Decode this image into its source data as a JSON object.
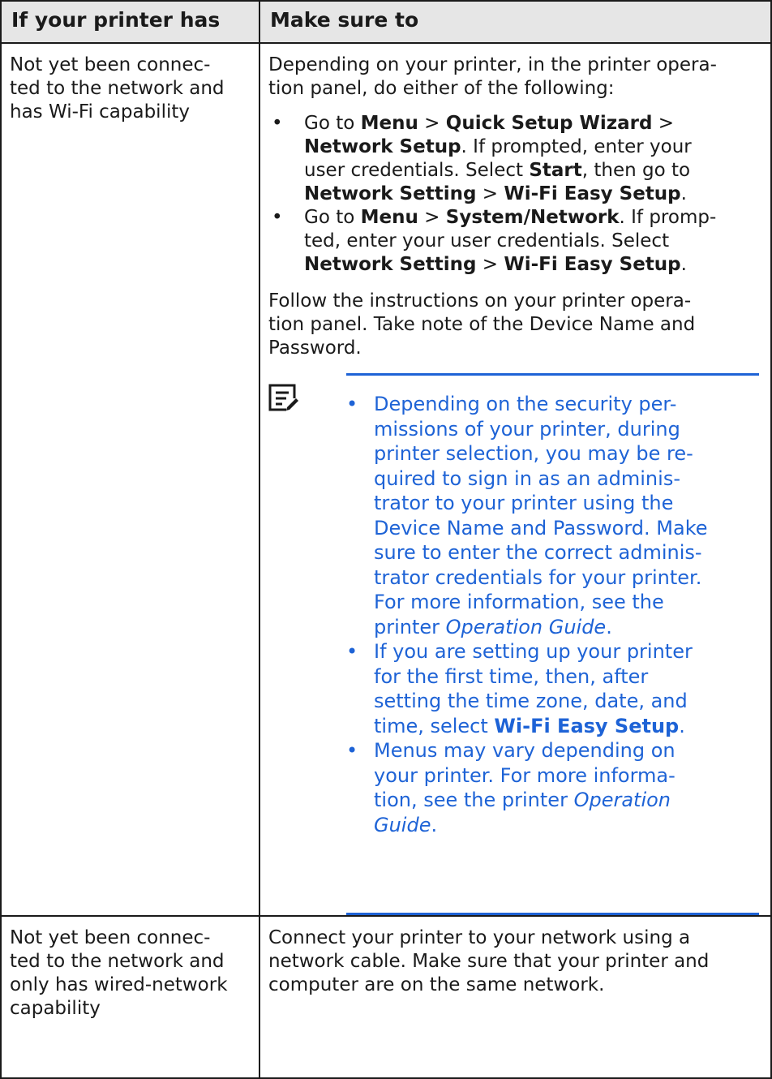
{
  "table": {
    "headers": [
      "If your printer has",
      "Make sure to"
    ],
    "row1": {
      "condition_lines": [
        "Not yet been connec-",
        "ted to the network and",
        "has Wi-Fi capability"
      ],
      "intro_lines": [
        "Depending on your printer, in the printer opera-",
        "tion panel, do either of the following:"
      ],
      "bullet": "•",
      "step1": {
        "t1": "Go to ",
        "b1": "Menu",
        "t2": " > ",
        "b2": "Quick Setup Wizard",
        "t3": " >",
        "b3": "Network Setup",
        "t4": ". If prompted, enter your",
        "t5": "user credentials. Select ",
        "b4": "Start",
        "t6": ", then go to",
        "b5": "Network Setting",
        "t7": " > ",
        "b6": "Wi-Fi Easy Setup",
        "t8": "."
      },
      "step2": {
        "t1": "Go to ",
        "b1": "Menu",
        "t2": " > ",
        "b2": "System/Network",
        "t3": ". If promp-",
        "t4": "ted, enter your user credentials. Select",
        "b3": "Network Setting",
        "t5": " > ",
        "b4": "Wi-Fi Easy Setup",
        "t6": "."
      },
      "follow_lines": [
        "Follow the instructions on your printer opera-",
        "tion panel. Take note of the Device Name and",
        "Password."
      ],
      "note": {
        "icon": "note-pencil-icon",
        "item1": {
          "lines": [
            "Depending on the security per-",
            "missions of your printer, during",
            "printer selection, you may be re-",
            "quired to sign in as an adminis-",
            "trator to your printer using the",
            "Device Name and Password. Make",
            "sure to enter the correct adminis-",
            "trator credentials for your printer.",
            "For more information, see the"
          ],
          "pre": "printer ",
          "em": "Operation Guide",
          "post": "."
        },
        "item2": {
          "lines": [
            "If you are setting up your printer",
            "for the first time, then, after",
            "setting the time zone, date, and"
          ],
          "pre": "time, select ",
          "strong": "Wi-Fi Easy Setup",
          "post": "."
        },
        "item3": {
          "lines": [
            "Menus may vary depending on",
            "your printer. For more informa-"
          ],
          "pre": "tion, see the printer ",
          "em1": "Operation",
          "em2": "Guide",
          "post": "."
        }
      }
    },
    "row2": {
      "condition_lines": [
        "Not yet been connec-",
        "ted to the network and",
        "only has wired-network",
        "capability"
      ],
      "action_lines": [
        "Connect your printer to your network using a",
        "network cable. Make sure that your printer and",
        "computer are on the same network."
      ]
    }
  },
  "colors": {
    "note_blue": "#1e63d6",
    "header_bg": "#e6e6e6",
    "text": "#1a1a1a"
  }
}
